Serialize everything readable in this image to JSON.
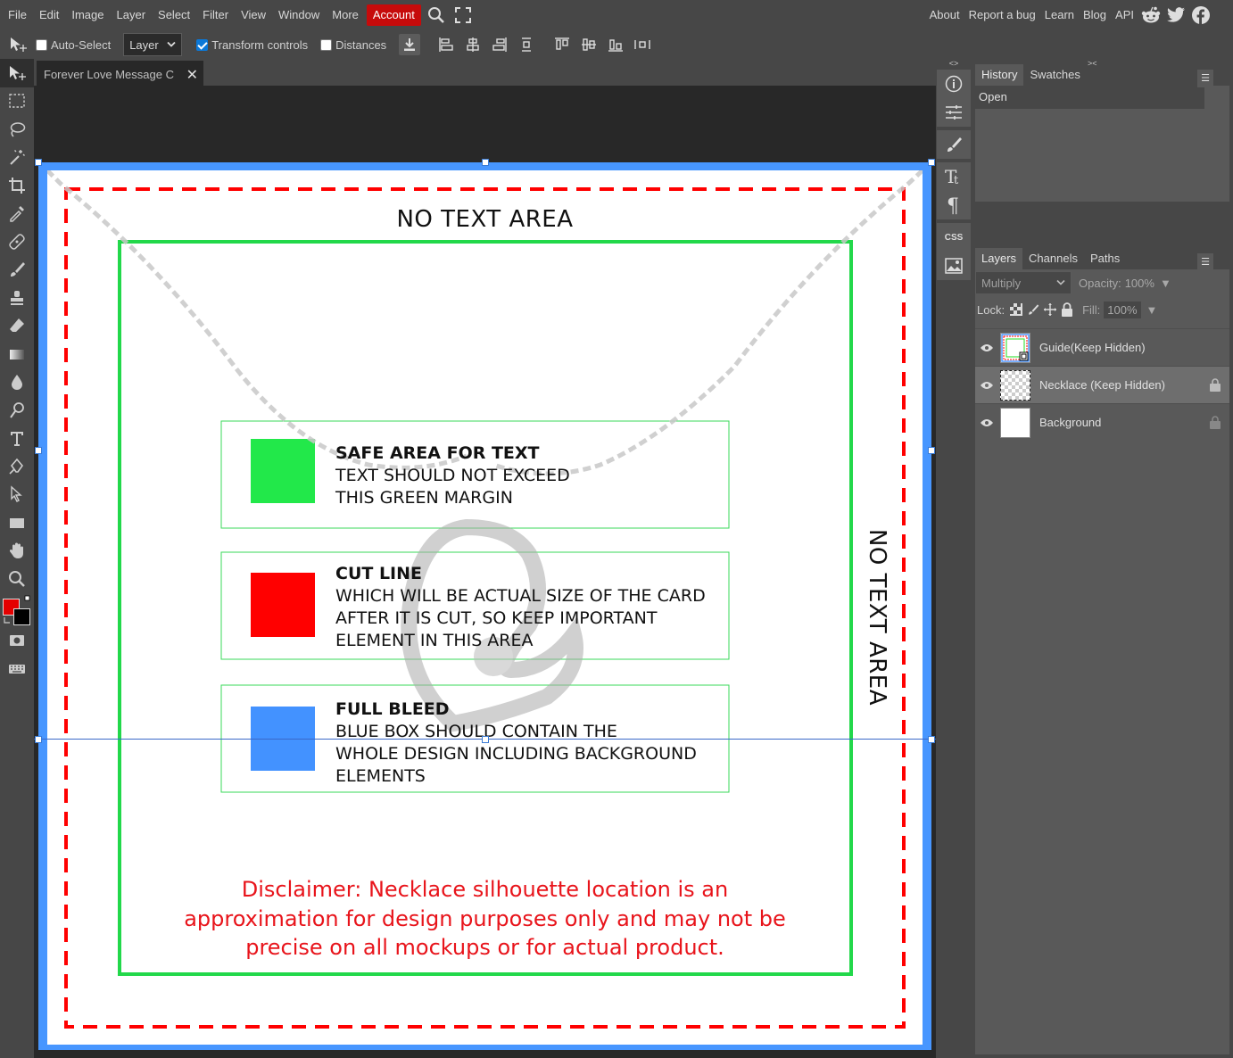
{
  "menu": {
    "items": [
      "File",
      "Edit",
      "Image",
      "Layer",
      "Select",
      "Filter",
      "View",
      "Window",
      "More"
    ],
    "account": "Account",
    "right_links": [
      "About",
      "Report a bug",
      "Learn",
      "Blog",
      "API"
    ]
  },
  "options": {
    "auto_select": "Auto-Select",
    "layer_select": "Layer",
    "transform_controls": "Transform controls",
    "distances": "Distances"
  },
  "document": {
    "tab_title": "Forever Love Message C"
  },
  "canvas": {
    "no_text_top": "NO TEXT AREA",
    "no_text_right": "NO TEXT AREA",
    "legend": [
      {
        "title": "SAFE AREA FOR TEXT",
        "lines": [
          "TEXT SHOULD NOT EXCEED",
          "THIS GREEN MARGIN"
        ],
        "color": "#22e84a"
      },
      {
        "title": "CUT LINE",
        "lines": [
          "WHICH WILL BE ACTUAL SIZE OF THE CARD",
          "AFTER IT IS CUT, SO KEEP IMPORTANT",
          "ELEMENT IN THIS AREA"
        ],
        "color": "#ff0000"
      },
      {
        "title": "FULL BLEED",
        "lines": [
          "BLUE BOX SHOULD CONTAIN THE",
          "WHOLE DESIGN INCLUDING BACKGROUND",
          "ELEMENTS"
        ],
        "color": "#4392ff"
      }
    ],
    "disclaimer": [
      "Disclaimer: Necklace silhouette location is an",
      "approximation for design purposes only and may not be",
      "precise on all mockups or for actual product."
    ]
  },
  "history": {
    "tabs": [
      "History",
      "Swatches"
    ],
    "items": [
      "Open"
    ]
  },
  "layers": {
    "tabs": [
      "Layers",
      "Channels",
      "Paths"
    ],
    "blend_mode": "Multiply",
    "opacity_label": "Opacity:",
    "opacity_value": "100%",
    "lock_label": "Lock:",
    "fill_label": "Fill:",
    "fill_value": "100%",
    "list": [
      {
        "name": "Guide(Keep Hidden)",
        "locked": false
      },
      {
        "name": "Necklace (Keep Hidden)",
        "locked": true
      },
      {
        "name": "Background",
        "locked": true
      }
    ]
  },
  "colors": {
    "foreground": "#e40000",
    "background": "#000000",
    "accent": "#c60b0b"
  }
}
